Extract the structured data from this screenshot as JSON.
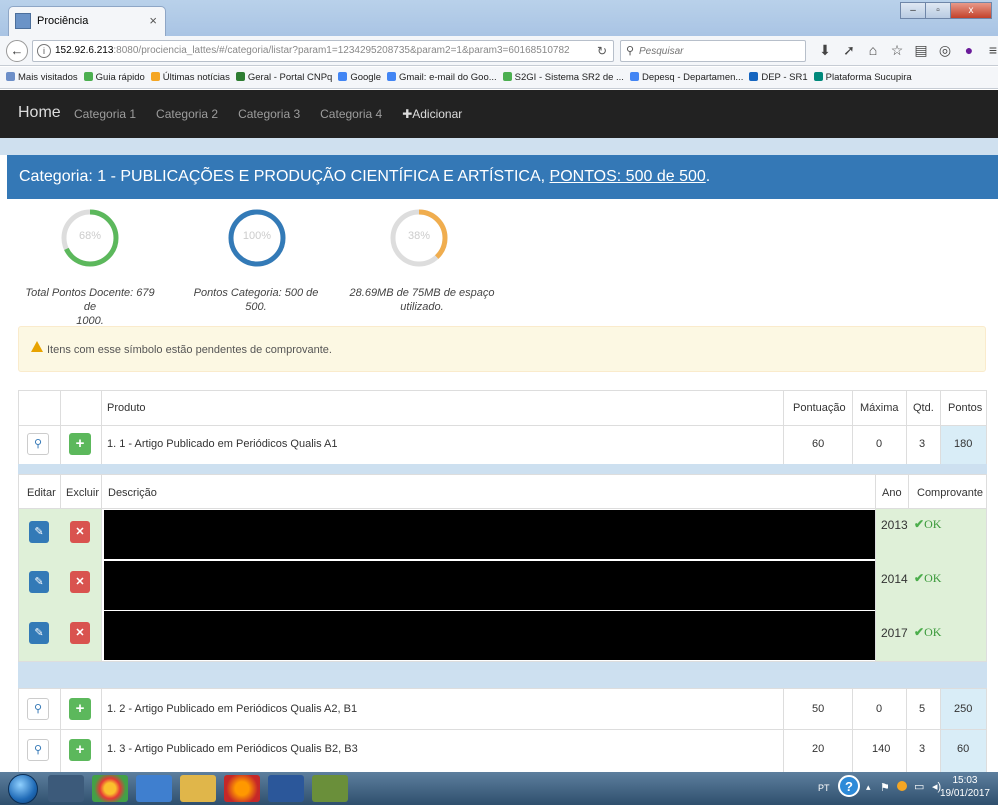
{
  "browser": {
    "tab_title": "Prociência",
    "tab_close": "×",
    "url_host": "152.92.6.213",
    "url_rest": ":8080/prociencia_lattes/#/categoria/listar?param1=1234295208735&param2=1&param3=60168510782",
    "search_placeholder": "Pesquisar",
    "bookmarks": [
      {
        "label": "Mais visitados",
        "color": "#6d8fc8"
      },
      {
        "label": "Guia rápido",
        "color": "#4caf50"
      },
      {
        "label": "Últimas notícias",
        "color": "#f5a623"
      },
      {
        "label": "Geral - Portal CNPq",
        "color": "#2e7d32"
      },
      {
        "label": "Google",
        "color": "#4285f4"
      },
      {
        "label": "Gmail: e-mail do Goo...",
        "color": "#4285f4"
      },
      {
        "label": "S2GI - Sistema SR2 de ...",
        "color": "#4caf50"
      },
      {
        "label": "Depesq - Departamen...",
        "color": "#4285f4"
      },
      {
        "label": "DEP - SR1",
        "color": "#1565c0"
      },
      {
        "label": "Plataforma Sucupira",
        "color": "#00897b"
      }
    ]
  },
  "nav": {
    "brand": "Home",
    "links": [
      "Categoria 1",
      "Categoria 2",
      "Categoria 3",
      "Categoria 4"
    ],
    "add_label": "✚Adicionar"
  },
  "heading": {
    "prefix": "Categoria: 1 - PUBLICAÇÕES E PRODUÇÃO CIENTÍFICA E ARTÍSTICA, ",
    "points_link": "PONTOS: 500 de 500",
    "suffix": "."
  },
  "progress": [
    {
      "percent_label": "68%",
      "value": 0.68,
      "color": "#5cb85c",
      "caption_line1": "Total Pontos Docente: 679 de",
      "caption_line2": "1000."
    },
    {
      "percent_label": "100%",
      "value": 1.0,
      "color": "#337ab7",
      "caption_line1": "Pontos Categoria: 500 de 500.",
      "caption_line2": ""
    },
    {
      "percent_label": "38%",
      "value": 0.38,
      "color": "#f0ad4e",
      "caption_line1": "28.69MB de 75MB de espaço",
      "caption_line2": "utilizado."
    }
  ],
  "alert": {
    "text": "Itens com esse símbolo estão pendentes de comprovante."
  },
  "table": {
    "headers": {
      "produto": "Produto",
      "pontuacao": "Pontuação",
      "maxima": "Máxima",
      "qtd": "Qtd.",
      "pontos": "Pontos"
    },
    "rows": [
      {
        "produto": "1. 1 - Artigo Publicado em Periódicos Qualis A1",
        "pontuacao": "60",
        "maxima": "0",
        "qtd": "3",
        "pontos": "180"
      },
      {
        "produto": "1. 2 - Artigo Publicado em Periódicos Qualis A2, B1",
        "pontuacao": "50",
        "maxima": "0",
        "qtd": "5",
        "pontos": "250"
      },
      {
        "produto": "1. 3 - Artigo Publicado em Periódicos Qualis B2, B3",
        "pontuacao": "20",
        "maxima": "140",
        "qtd": "3",
        "pontos": "60"
      }
    ]
  },
  "inner": {
    "headers": {
      "editar": "Editar",
      "excluir": "Excluir",
      "descricao": "Descrição",
      "ano": "Ano",
      "comprovante": "Comprovante"
    },
    "rows": [
      {
        "ano": "2013",
        "comprovante": "OK"
      },
      {
        "ano": "2014",
        "comprovante": "OK"
      },
      {
        "ano": "2017",
        "comprovante": "OK"
      }
    ]
  },
  "taskbar": {
    "lang": "PT",
    "time": "15:03",
    "date": "19/01/2017"
  }
}
